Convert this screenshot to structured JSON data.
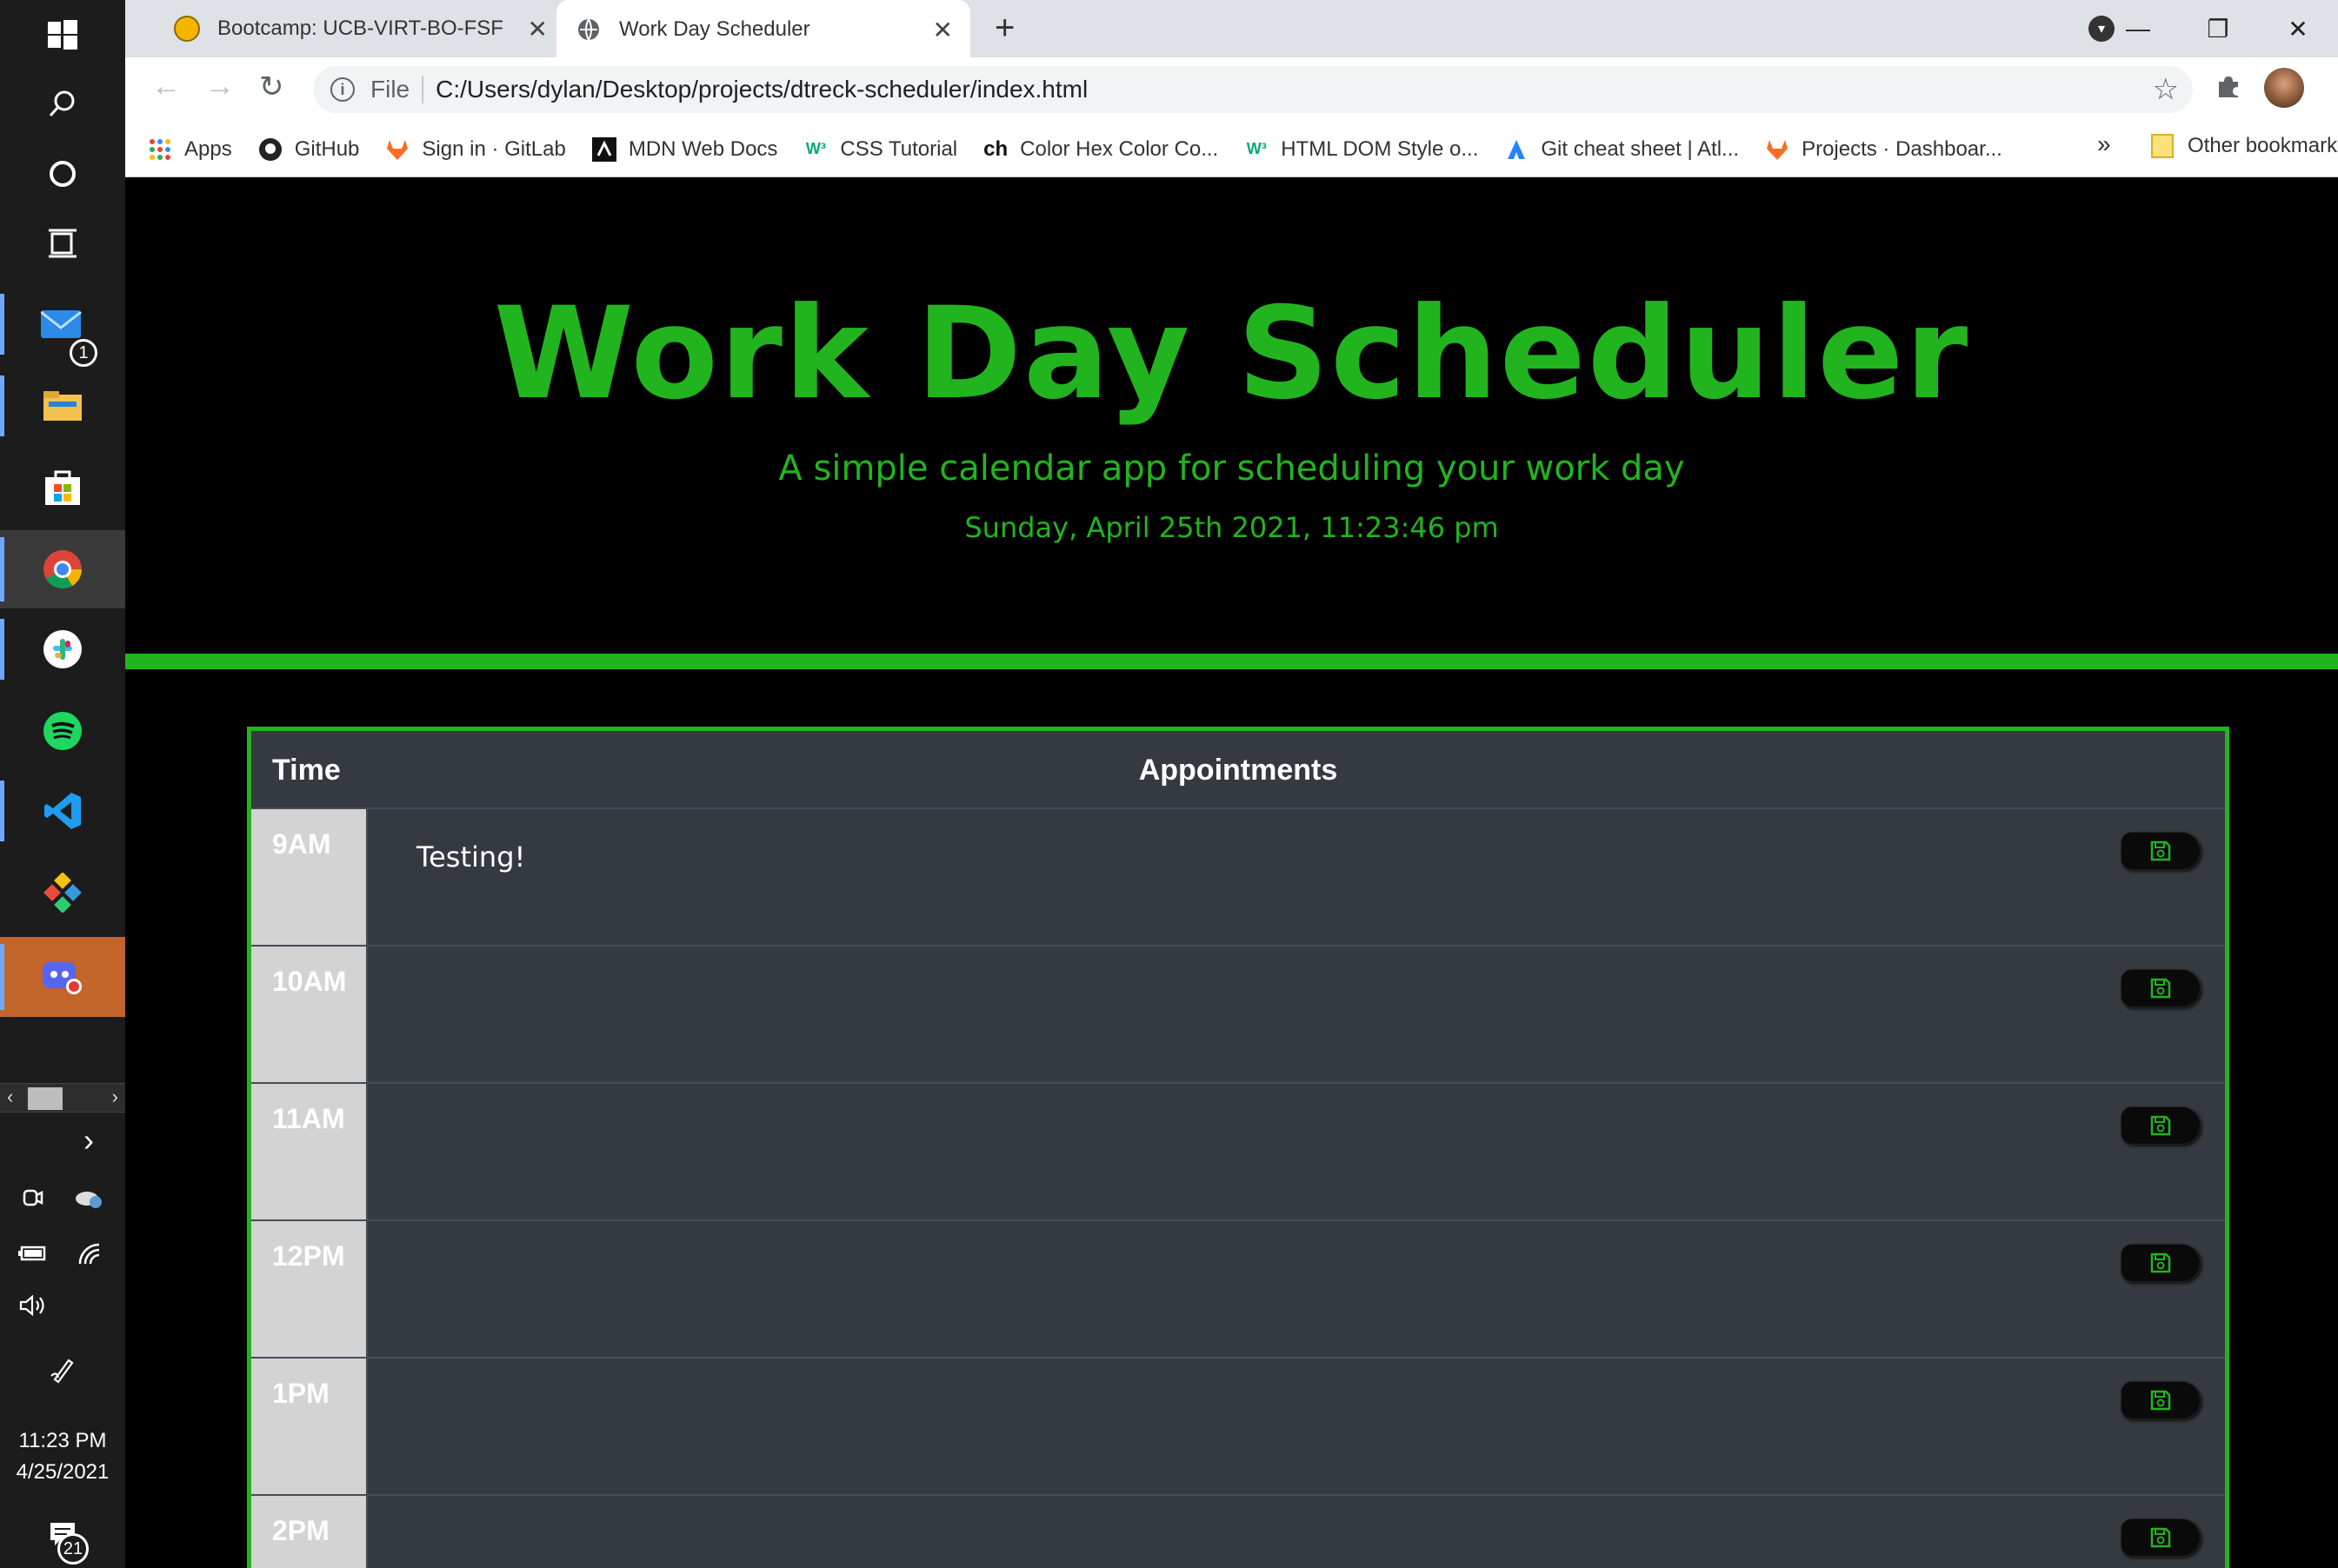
{
  "taskbar": {
    "mail_badge": "1",
    "clock_time": "11:23 PM",
    "clock_date": "4/25/2021",
    "notification_count": "21",
    "tray_chevron": "›"
  },
  "browser": {
    "tabs": [
      {
        "title": "Bootcamp: UCB-VIRT-BO-FSF-PT"
      },
      {
        "title": "Work Day Scheduler"
      }
    ],
    "address": {
      "scheme": "File",
      "url": "C:/Users/dylan/Desktop/projects/dtreck-scheduler/index.html"
    },
    "bookmarks": [
      {
        "label": "Apps"
      },
      {
        "label": "GitHub"
      },
      {
        "label": "Sign in · GitLab"
      },
      {
        "label": "MDN Web Docs"
      },
      {
        "label": "CSS Tutorial"
      },
      {
        "label": "Color Hex Color Co..."
      },
      {
        "label": "HTML DOM Style o..."
      },
      {
        "label": "Git cheat sheet | Atl..."
      },
      {
        "label": "Projects · Dashboar..."
      }
    ],
    "bookmarks_more": "»",
    "other_bookmarks": "Other bookmarks"
  },
  "page": {
    "title": "Work Day Scheduler",
    "lead": "A simple calendar app for scheduling your work day",
    "current_day": "Sunday, April 25th 2021, 11:23:46 pm",
    "table": {
      "col_time": "Time",
      "col_appointments": "Appointments",
      "rows": [
        {
          "hour": "9AM",
          "text": "Testing!"
        },
        {
          "hour": "10AM",
          "text": ""
        },
        {
          "hour": "11AM",
          "text": ""
        },
        {
          "hour": "12PM",
          "text": ""
        },
        {
          "hour": "1PM",
          "text": ""
        },
        {
          "hour": "2PM",
          "text": ""
        }
      ]
    }
  },
  "colors": {
    "accent_green": "#22b41f",
    "row_bg": "#343a40",
    "hour_bg": "#d3d3d3"
  },
  "icons": {
    "save": "floppy-disk-icon"
  }
}
